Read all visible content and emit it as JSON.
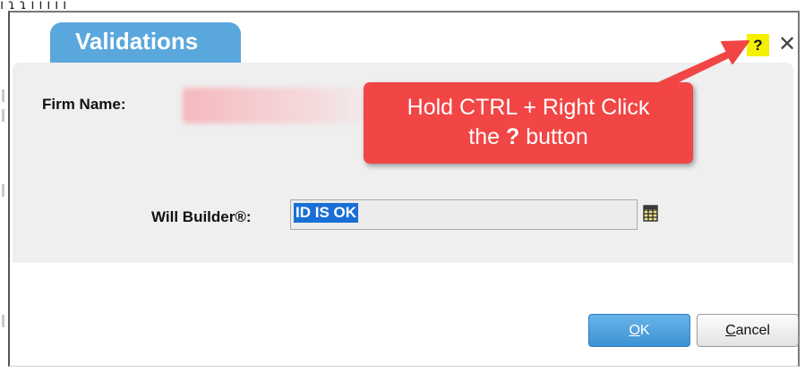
{
  "dialog": {
    "title": "Validations",
    "help_label": "?",
    "close_label": "✕"
  },
  "form": {
    "firm_name_label": "Firm Name:",
    "will_builder_label": "Will Builder®:",
    "will_builder_value": "ID IS OK"
  },
  "buttons": {
    "ok_label": "OK",
    "cancel_label": "Cancel"
  },
  "callout": {
    "line1": "Hold CTRL + Right Click",
    "line2_prefix": "the ",
    "line2_key": "?",
    "line2_suffix": " button"
  },
  "colors": {
    "title_tab": "#5aa7dd",
    "callout": "#f24545",
    "help_highlight": "#f4f000",
    "ok_button": "#3e92d3"
  },
  "icons": {
    "lookup": "lookup-grid-icon",
    "close": "close-icon",
    "arrow": "arrow-icon"
  }
}
